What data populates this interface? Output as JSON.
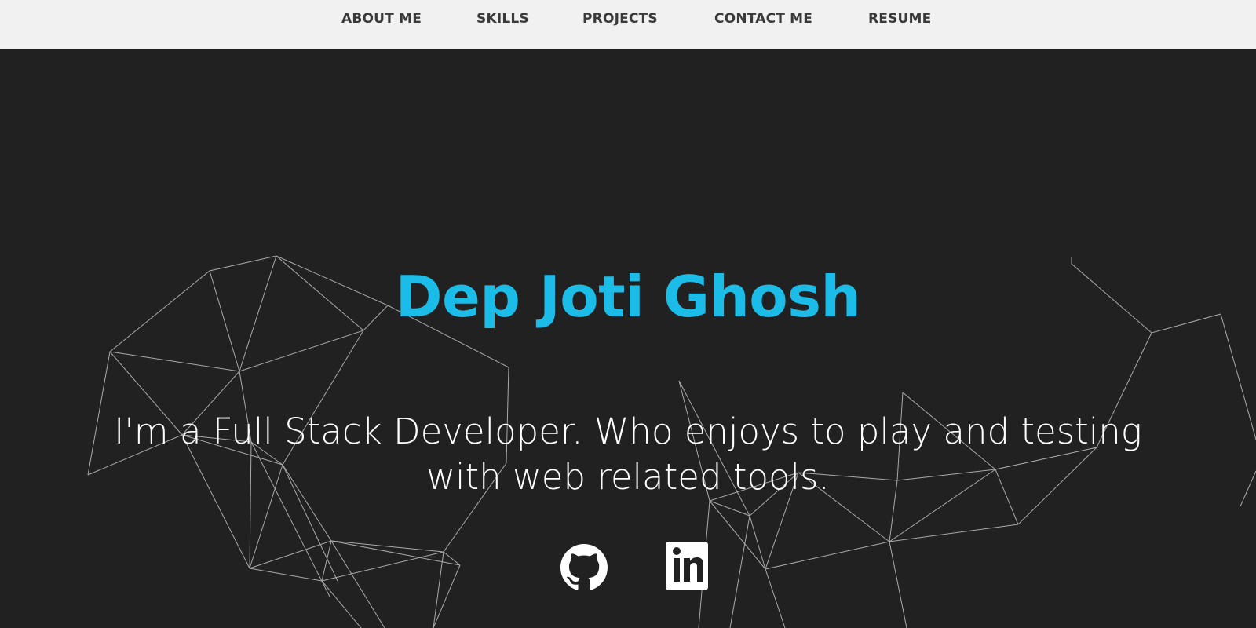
{
  "nav": {
    "items": [
      {
        "label": "ABOUT ME"
      },
      {
        "label": "SKILLS"
      },
      {
        "label": "PROJECTS"
      },
      {
        "label": "CONTACT ME"
      },
      {
        "label": "RESUME"
      }
    ]
  },
  "hero": {
    "name": "Dep Joti Ghosh",
    "tagline": "I'm a Full Stack Developer. Who enjoys to play and testing with web related tools."
  },
  "social": [
    {
      "icon": "github-icon"
    },
    {
      "icon": "linkedin-icon"
    }
  ],
  "colors": {
    "nav_bg": "#f1f1f1",
    "nav_text": "#3a3a3a",
    "hero_bg": "#212121",
    "name": "#1bbce8",
    "tagline": "#ffffff"
  }
}
